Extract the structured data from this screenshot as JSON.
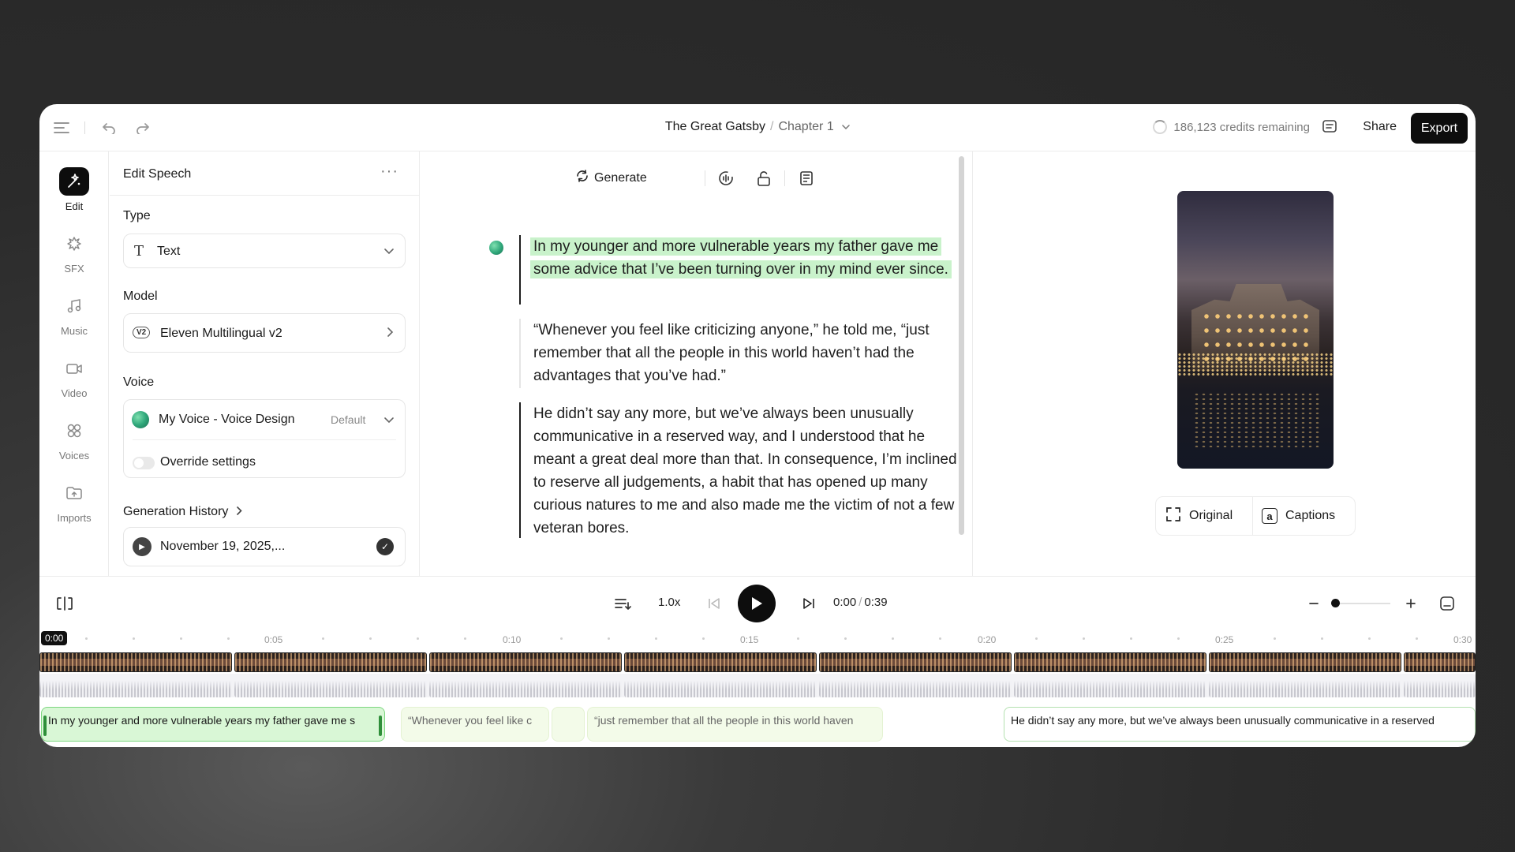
{
  "header": {
    "project_title": "The Great Gatsby",
    "separator": "/",
    "chapter": "Chapter 1",
    "credits": "186,123 credits remaining",
    "share_label": "Share",
    "export_label": "Export"
  },
  "rail": {
    "items": [
      {
        "label": "Edit"
      },
      {
        "label": "SFX"
      },
      {
        "label": "Music"
      },
      {
        "label": "Video"
      },
      {
        "label": "Voices"
      },
      {
        "label": "Imports"
      }
    ]
  },
  "panel": {
    "title": "Edit Speech",
    "type_label": "Type",
    "type_value": "Text",
    "model_label": "Model",
    "model_badge": "V2",
    "model_value": "Eleven Multilingual v2",
    "voice_label": "Voice",
    "voice_value": "My Voice - Voice Design",
    "voice_tag": "Default",
    "override_label": "Override settings",
    "history_label": "Generation History",
    "history_item": "November 19, 2025,..."
  },
  "editor": {
    "generate_label": "Generate",
    "paragraphs": [
      "In my younger and more vulnerable years my father gave me some advice that I’ve been turning over in my mind ever since.",
      "“Whenever you feel like criticizing anyone,” he told me, “just remember that all the people in this world haven’t had the advantages that you’ve had.”",
      "He didn’t say any more, but we’ve always been unusually communicative in a reserved way, and I understood that he meant a great deal more than that. In consequence, I’m inclined to reserve all judgements, a habit that has opened up many curious natures to me and also made me the victim of not a few veteran bores."
    ]
  },
  "preview": {
    "original_label": "Original",
    "captions_label": "Captions",
    "captions_icon_letter": "a"
  },
  "transport": {
    "speed": "1.0x",
    "current_time": "0:00",
    "time_sep": "/",
    "duration": "0:39"
  },
  "timeline": {
    "playhead": "0:00",
    "ticks": [
      "0:05",
      "0:10",
      "0:15",
      "0:20",
      "0:25",
      "0:30"
    ],
    "captions": [
      "In my younger and more vulnerable years my father gave me s",
      "“Whenever you feel like c",
      "“just remember that all the people in this world haven",
      "He didn’t say any more, but we’ve always been unusually communicative in a reserved"
    ]
  },
  "colors": {
    "accent_dark": "#0d0d0d",
    "highlight_green": "#c9f2cb",
    "caption_active": "#d9f7d6"
  }
}
